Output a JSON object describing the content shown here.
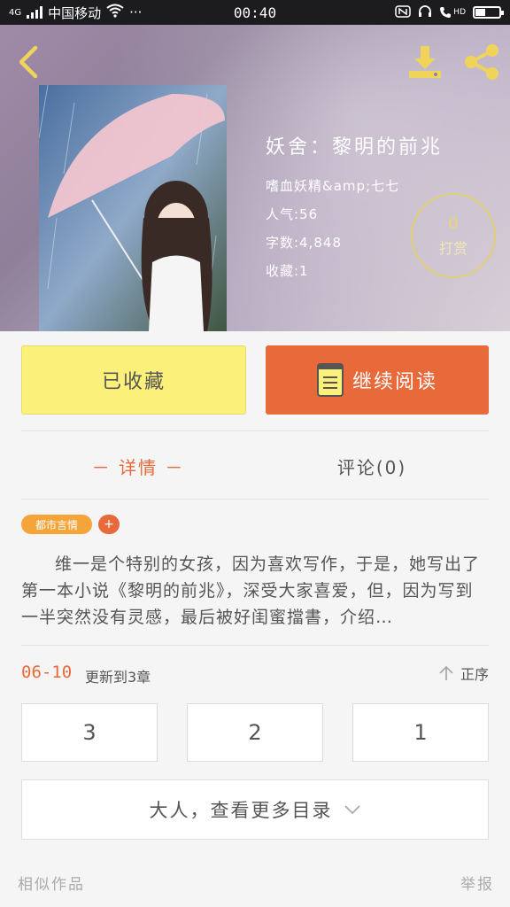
{
  "status_bar": {
    "network": "4G",
    "carrier": "中国移动",
    "dots": "···",
    "time": "00:40",
    "hd": "HD"
  },
  "book": {
    "title": "妖舍：黎明的前兆",
    "author": "嗜血妖精&amp;七七",
    "popularity": "人气:56",
    "word_count": "字数:4,848",
    "favorites": "收藏:1"
  },
  "reward": {
    "count": "0",
    "label": "打赏"
  },
  "actions": {
    "favorite_label": "已收藏",
    "read_label": "继续阅读"
  },
  "tabs": {
    "detail": "－ 详情 －",
    "comment": "评论(0)"
  },
  "tags": {
    "category": "都市言情",
    "add": "+"
  },
  "description": "维一是个特别的女孩，因为喜欢写作，于是，她写出了第一本小说《黎明的前兆》，深受大家喜爱，但，因为写到一半突然没有灵感，最后被好闺蜜擋書，介绍…",
  "update": {
    "date": "06-10",
    "text": "更新到3章",
    "sort_label": "正序"
  },
  "chapters": [
    "3",
    "2",
    "1"
  ],
  "more_label": "大人，查看更多目录",
  "footer": {
    "similar": "相似作品",
    "report": "举报"
  },
  "colors": {
    "accent": "#e8693a",
    "favorite_bg": "#fbf17a",
    "tag": "#f5a43a"
  }
}
